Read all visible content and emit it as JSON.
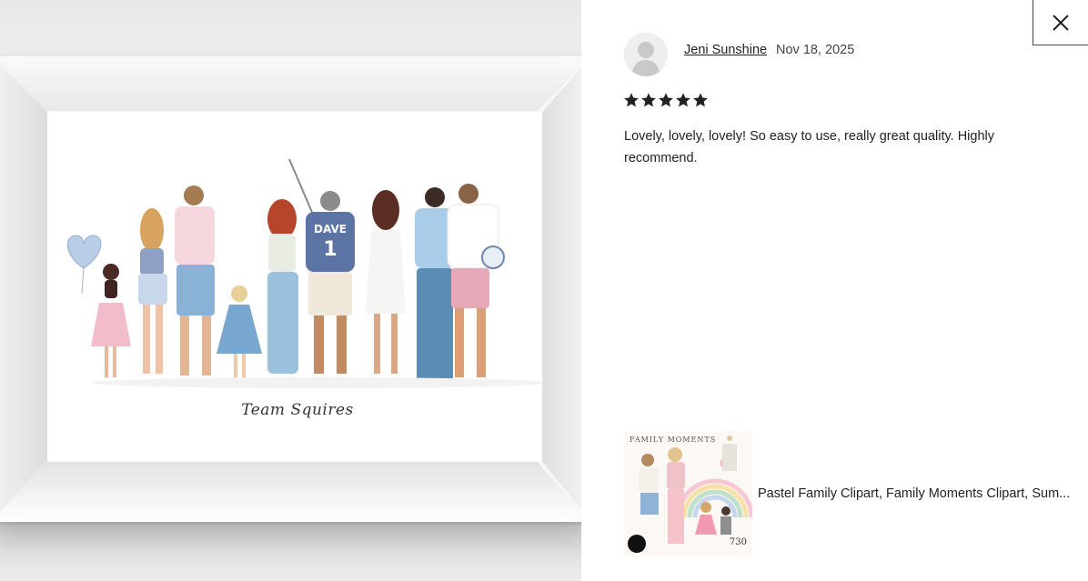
{
  "review": {
    "reviewer_name": "Jeni Sunshine",
    "date": "Nov 18, 2025",
    "rating": 5,
    "rating_max": 5,
    "text": "Lovely, lovely, lovely! So easy to use, really great quality. Highly recommend."
  },
  "photo": {
    "signature": "Team Squires",
    "jersey_name": "DAVE",
    "jersey_number": "1"
  },
  "product": {
    "title": "Pastel Family Clipart, Family Moments Clipart, Sum...",
    "thumb_title": "FAMILY MOMENTS",
    "thumb_count": "730"
  },
  "icons": {
    "close": "close-icon",
    "star": "star-icon",
    "avatar": "user-avatar-icon"
  },
  "colors": {
    "star": "#222222",
    "close_border": "#3b4a6b"
  }
}
